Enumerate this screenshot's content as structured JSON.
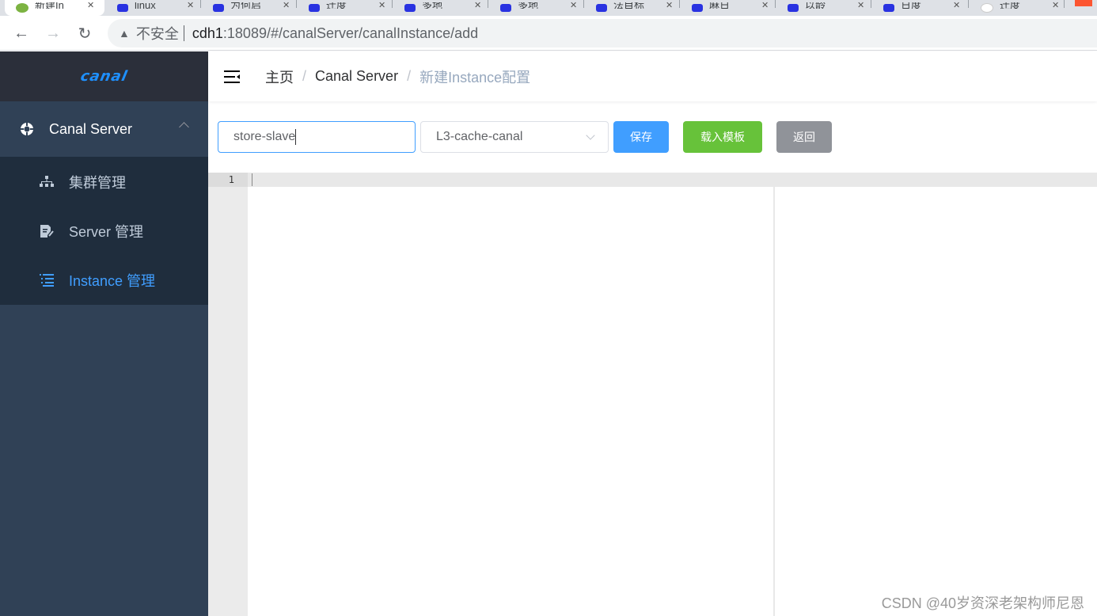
{
  "browser": {
    "tabs": [
      {
        "label": "新建In",
        "favicon": "canal-leaf-icon",
        "active": true
      },
      {
        "label": "linux",
        "favicon": "baidu-icon"
      },
      {
        "label": "为何启",
        "favicon": "baidu-icon"
      },
      {
        "label": "迁度",
        "favicon": "baidu-icon"
      },
      {
        "label": "多地",
        "favicon": "baidu-icon"
      },
      {
        "label": "多地",
        "favicon": "baidu-icon"
      },
      {
        "label": "法目标",
        "favicon": "baidu-icon"
      },
      {
        "label": "麻日",
        "favicon": "baidu-icon"
      },
      {
        "label": "以龄",
        "favicon": "baidu-icon"
      },
      {
        "label": "日度",
        "favicon": "baidu-icon"
      },
      {
        "label": "迁度",
        "favicon": "site-icon"
      }
    ],
    "security_label": "不安全",
    "url_host": "cdh1",
    "url_path": ":18089/#/canalServer/canalInstance/add"
  },
  "sidebar": {
    "logo": "canal",
    "group": {
      "label": "Canal Server",
      "icon": "canal-server-icon",
      "expanded": true
    },
    "items": [
      {
        "label": "集群管理",
        "icon": "cluster-tree-icon",
        "active": false
      },
      {
        "label": "Server 管理",
        "icon": "server-edit-icon",
        "active": false
      },
      {
        "label": "Instance 管理",
        "icon": "instance-list-icon",
        "active": true
      }
    ]
  },
  "navbar": {
    "breadcrumb": [
      "主页",
      "Canal Server",
      "新建Instance配置"
    ]
  },
  "form": {
    "instance_name": "store-slave",
    "cluster_select": "L3-cache-canal",
    "save_label": "保存",
    "load_template_label": "载入模板",
    "back_label": "返回"
  },
  "editor": {
    "line_numbers": [
      "1"
    ],
    "content": ""
  },
  "colors": {
    "primary": "#409eff",
    "success": "#67c23a",
    "info": "#909399",
    "sidebar_bg": "#304156",
    "submenu_bg": "#1f2d3d"
  },
  "watermark": "CSDN @40岁资深老架构师尼恩"
}
